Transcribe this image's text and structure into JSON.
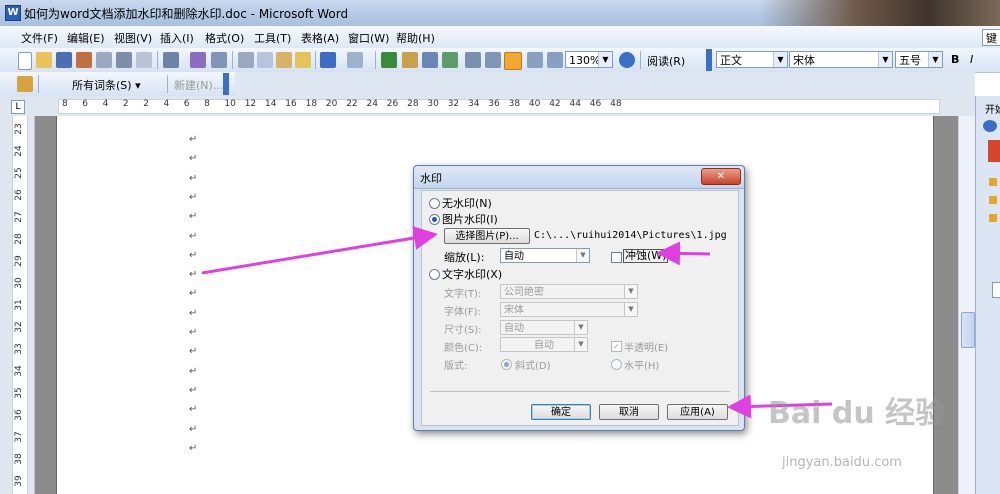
{
  "window": {
    "title": "如何为word文档添加水印和删除水印.doc - Microsoft Word",
    "app_icon_letter": "W"
  },
  "menubar": {
    "items": [
      "文件(F)",
      "编辑(E)",
      "视图(V)",
      "插入(I)",
      "格式(O)",
      "工具(T)",
      "表格(A)",
      "窗口(W)",
      "帮助(H)"
    ],
    "help_search": "键"
  },
  "toolbar": {
    "zoom": "130%",
    "read_mode": "阅读(R)",
    "style": "正文",
    "font": "宋体",
    "size": "五号",
    "bold": "B",
    "italic": "I",
    "all_entries": "所有词条(S)",
    "new_entry": "新建(N)..."
  },
  "ruler": {
    "numbers": [
      "8",
      "6",
      "4",
      "2",
      "2",
      "4",
      "6",
      "8",
      "10",
      "12",
      "14",
      "16",
      "18",
      "20",
      "22",
      "24",
      "26",
      "28",
      "30",
      "32",
      "34",
      "36",
      "38",
      "40",
      "42",
      "44",
      "46",
      "48"
    ]
  },
  "vruler": {
    "numbers": [
      "23",
      "24",
      "25",
      "26",
      "27",
      "28",
      "29",
      "30",
      "31",
      "32",
      "33",
      "34",
      "35",
      "36",
      "37",
      "38",
      "39"
    ]
  },
  "document": {
    "paragraph_mark": "↵"
  },
  "taskpane": {
    "title": "开始"
  },
  "dialog": {
    "title": "水印",
    "close": "✕",
    "no_watermark": "无水印(N)",
    "picture_watermark": "图片水印(I)",
    "select_picture": "选择图片(P)...",
    "picture_path": "C:\\...\\ruihui2014\\Pictures\\1.jpg",
    "scale_label": "缩放(L):",
    "scale_value": "自动",
    "washout_label": "冲蚀(W)",
    "text_watermark": "文字水印(X)",
    "text_label": "文字(T):",
    "text_value": "公司绝密",
    "font_label": "字体(F):",
    "font_value": "宋体",
    "size_label": "尺寸(S):",
    "size_value": "自动",
    "color_label": "颜色(C):",
    "color_value": "自动",
    "semitransparent_label": "半透明(E)",
    "layout_label": "版式:",
    "diagonal_label": "斜式(D)",
    "horizontal_label": "水平(H)",
    "ok": "确定",
    "cancel": "取消",
    "apply": "应用(A)",
    "selected_option": "picture_watermark",
    "semitransparent_checked": true,
    "washout_checked": false
  },
  "watermark": {
    "logo": "Bai du 经验",
    "url": "jingyan.baidu.com"
  },
  "colors": {
    "annotation_arrow": "#e040e0",
    "accent": "#1d5cb8"
  }
}
